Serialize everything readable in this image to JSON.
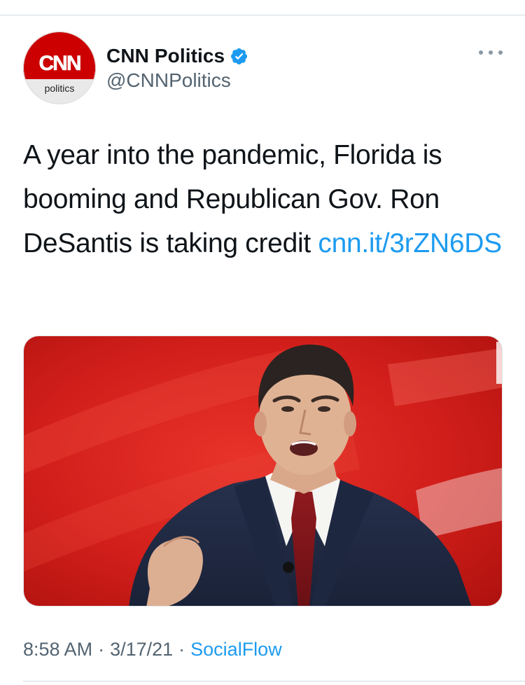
{
  "tweet": {
    "avatar": {
      "logo_text": "CNN",
      "sub_label": "politics",
      "brand_red": "#cc0000"
    },
    "author": {
      "display_name": "CNN Politics",
      "handle": "@CNNPolitics",
      "verified": true,
      "verified_color": "#1d9bf0"
    },
    "more_icon": "more-horizontal-icon",
    "text": {
      "body": "A year into the pandemic, Florida is booming and Republican Gov. Ron DeSantis is taking credit ",
      "link": "cnn.it/3rZN6DS"
    },
    "media": {
      "type": "photo",
      "subject": "DeSantis speaking at a podium"
    },
    "meta": {
      "time": "8:58 AM",
      "separator": "·",
      "date": "3/17/21",
      "source": "SocialFlow"
    }
  },
  "colors": {
    "link": "#1d9bf0",
    "secondary_text": "#536471",
    "divider": "#cfd9de"
  }
}
